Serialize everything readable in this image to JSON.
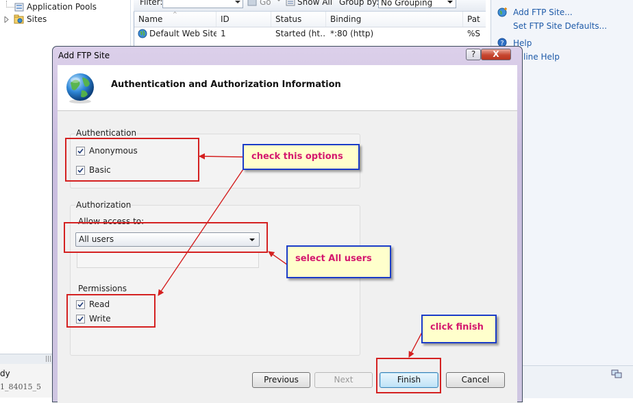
{
  "tree": {
    "items": [
      {
        "label": "Application Pools"
      },
      {
        "label": "Sites"
      }
    ]
  },
  "status_bar": {
    "line1": "dy",
    "line2": "1_84015_5"
  },
  "filter_bar": {
    "filter_label": "Filter:",
    "go_label": "Go",
    "show_all_label": "Show All",
    "group_by_label": "Group by:",
    "group_by_value": "No Grouping"
  },
  "grid": {
    "headers": [
      "Name",
      "ID",
      "Status",
      "Binding",
      "Pat"
    ],
    "rows": [
      {
        "name": "Default Web Site",
        "id": "1",
        "status": "Started (ht…",
        "binding": "*:80 (http)",
        "path": "%S"
      }
    ]
  },
  "actions": {
    "add_ftp_site": "Add FTP Site...",
    "set_ftp_defaults": "Set FTP Site Defaults...",
    "help": "Help",
    "online_help": "line Help"
  },
  "dialog": {
    "title": "Add FTP Site",
    "help_button": "?",
    "close_button": "X",
    "heading": "Authentication and Authorization Information",
    "authentication": {
      "label": "Authentication",
      "anonymous": {
        "label": "Anonymous",
        "checked": true
      },
      "basic": {
        "label": "Basic",
        "checked": true
      }
    },
    "authorization": {
      "label": "Authorization",
      "allow_access_label": "Allow access to:",
      "allow_access_value": "All users"
    },
    "permissions": {
      "label": "Permissions",
      "read": {
        "label": "Read",
        "checked": true
      },
      "write": {
        "label": "Write",
        "checked": true
      }
    },
    "buttons": {
      "previous": "Previous",
      "next": "Next",
      "finish": "Finish",
      "cancel": "Cancel"
    }
  },
  "annotations": {
    "check_options": "check this options",
    "select_all_users": "select All users",
    "click_finish": "click finish",
    "highlight_color": "#d42020",
    "callout_border_color": "#1a3cc8",
    "callout_text_color": "#d4186e",
    "callout_background": "#ffffcc"
  }
}
